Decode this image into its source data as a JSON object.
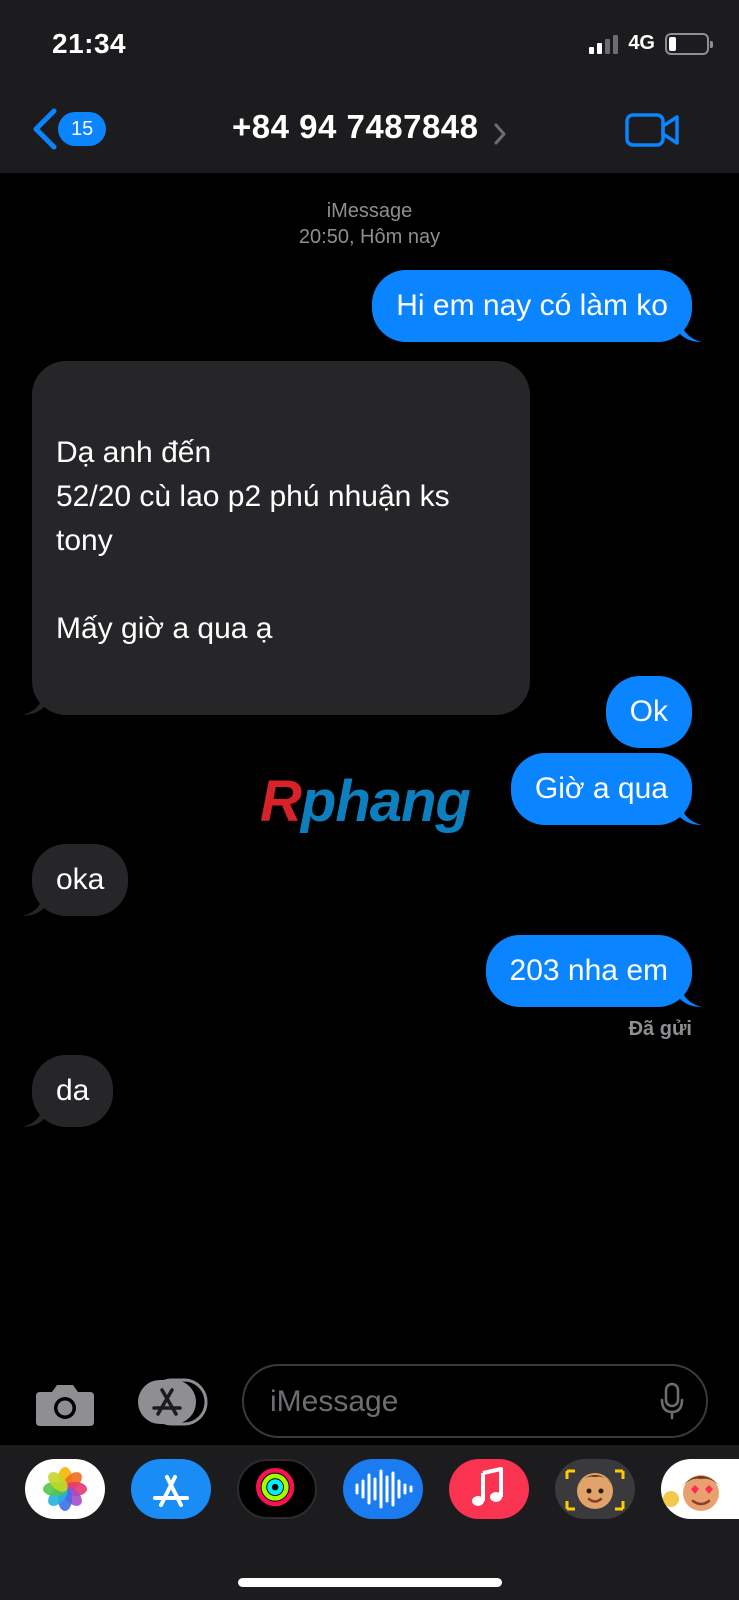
{
  "status_bar": {
    "time": "21:34",
    "network": "4G",
    "battery_level": 0.2
  },
  "header": {
    "back_count": "15",
    "contact": "+84 94 7487848",
    "video_icon": "video-camera-icon"
  },
  "thread": {
    "service": "iMessage",
    "timestamp": "20:50, Hôm nay",
    "messages": [
      {
        "dir": "out",
        "text": "Hi em nay có làm ko"
      },
      {
        "dir": "in",
        "text": "Dạ anh đến\n52/20 cù lao p2 phú nhuận ks\ntony\n\nMấy giờ a qua ạ"
      },
      {
        "dir": "out",
        "text": "Ok"
      },
      {
        "dir": "out",
        "text": "Giờ a qua"
      },
      {
        "dir": "in",
        "text": "oka"
      },
      {
        "dir": "out",
        "text": "203 nha em"
      },
      {
        "dir": "in",
        "text": "da"
      }
    ],
    "delivered": "Đã gửi"
  },
  "watermark": {
    "part1": "R",
    "part2": "phang"
  },
  "composer": {
    "placeholder": "iMessage"
  },
  "app_drawer": [
    "photos-app",
    "app-store-app",
    "activity-app",
    "audio-message-app",
    "music-app",
    "memoji-app",
    "animoji-app"
  ],
  "colors": {
    "accent": "#0a84ff",
    "incoming": "#262629",
    "bar": "#1c1c1e"
  }
}
